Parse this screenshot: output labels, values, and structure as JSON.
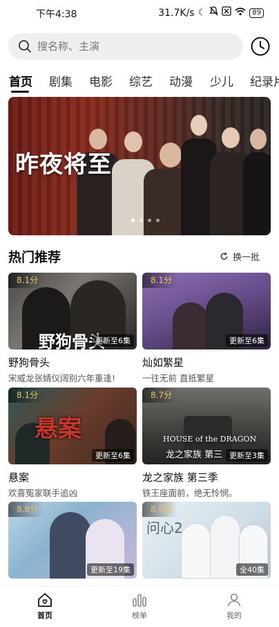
{
  "status": {
    "time": "下午4:38",
    "net_speed": "31.7K/s",
    "battery": "89",
    "icons": [
      "moon-icon",
      "mute-icon",
      "sim-off-icon",
      "wifi-icon",
      "battery-icon"
    ]
  },
  "search": {
    "placeholder": "搜名称、主演"
  },
  "tabs": [
    {
      "label": "首页",
      "active": true
    },
    {
      "label": "剧集"
    },
    {
      "label": "电影"
    },
    {
      "label": "综艺"
    },
    {
      "label": "动漫"
    },
    {
      "label": "少儿"
    },
    {
      "label": "纪录片"
    }
  ],
  "banner": {
    "title": "昨夜将至",
    "page_count": 4,
    "active_index": 0
  },
  "section": {
    "title": "热门推荐",
    "refresh_label": "换一批"
  },
  "cards": [
    {
      "score": "8.1分",
      "episodes": "更新至6集",
      "title": "野狗骨头",
      "desc": "宋威龙张婧仪阔别六年重逢!",
      "caption": "野狗骨头"
    },
    {
      "score": "8.1分",
      "episodes": "更新至6集",
      "title": "灿如繁星",
      "desc": "一往无前 直抵繁星"
    },
    {
      "score": "8.1分",
      "episodes": "更新至6集",
      "title": "悬案",
      "desc": "欢喜冤家联手追凶",
      "caption": "悬案"
    },
    {
      "score": "8.7分",
      "episodes": "更新至3集",
      "title": "龙之家族 第三季",
      "desc": "铁王座面前，绝无怜悯。",
      "caption": "HOUSE of the DRAGON",
      "caption2": "龙之家族 第三"
    },
    {
      "score": "8.8分",
      "episodes": "更新至19集",
      "title": "",
      "desc": ""
    },
    {
      "score": "8.9分",
      "episodes": "全40集",
      "title": "",
      "desc": "",
      "caption": "问心2"
    }
  ],
  "nav": [
    {
      "label": "首页",
      "icon": "home-icon",
      "active": true
    },
    {
      "label": "榜单",
      "icon": "chart-icon"
    },
    {
      "label": "我的",
      "icon": "profile-icon"
    }
  ],
  "colors": {
    "score": "#f3c35f",
    "search_bg": "#efefef",
    "banner_red": "#8a2a1d"
  }
}
